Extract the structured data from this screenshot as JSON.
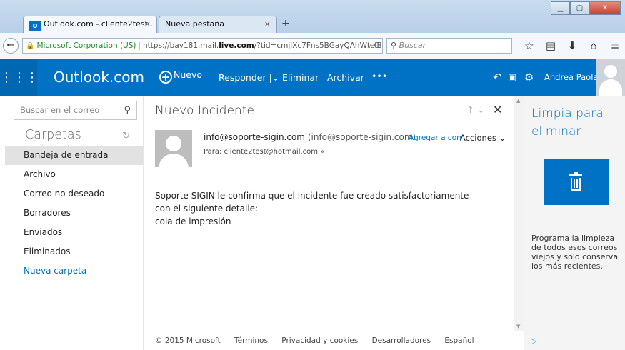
{
  "browser": {
    "tabs": [
      {
        "title": "Outlook.com - cliente2test...",
        "close": "×"
      },
      {
        "title": "Nueva pestaña",
        "close": "×"
      }
    ],
    "new_tab": "+",
    "window_buttons": {
      "minimize": "▁",
      "maximize": "▢",
      "close": "✕"
    },
    "back": "←",
    "address": {
      "identity": "Microsoft Corporation (US)",
      "url_prefix": "https://bay181.mail.",
      "url_host": "live.com",
      "url_rest": "/?tid=cmjlXc7Fns5BGayQAhWtelB",
      "tail": "▿ C"
    },
    "search_placeholder": "Buscar",
    "icons": [
      "star-icon",
      "reading-list-icon",
      "download-icon",
      "home-icon",
      "menu-icon"
    ]
  },
  "header": {
    "brand": "Outlook.com",
    "new_label": "Nuevo",
    "reply_label": "Responder",
    "delete_label": "Eliminar",
    "archive_label": "Archivar",
    "more_label": "•••",
    "user_name": "Andrea Paola"
  },
  "sidebar": {
    "search_placeholder": "Buscar en el correo",
    "folders_header": "Carpetas",
    "folders": [
      {
        "label": "Bandeja de entrada",
        "selected": true
      },
      {
        "label": "Archivo"
      },
      {
        "label": "Correo no deseado"
      },
      {
        "label": "Borradores"
      },
      {
        "label": "Enviados"
      },
      {
        "label": "Eliminados"
      }
    ],
    "new_folder": "Nueva carpeta"
  },
  "message": {
    "subject": "Nuevo Incidente",
    "from_email": "info@soporte-sigin.com",
    "from_display": "(info@soporte-sigin.com)",
    "add_contact": "Agregar a con",
    "actions": "Acciones",
    "to_line": "Para: cliente2test@hotmail.com",
    "body_lines": [
      "Soporte SIGIN le confirma que el incidente fue creado satisfactoriamente",
      "con el siguiente detalle:",
      "cola de impresión"
    ]
  },
  "ad": {
    "title": "Limpia para eliminar",
    "text": "Programa la limpieza de todos esos correos viejos y solo conserva los más recientes."
  },
  "footer": {
    "copyright": "© 2015 Microsoft",
    "links": [
      "Términos",
      "Privacidad y cookies",
      "Desarrolladores",
      "Español"
    ]
  },
  "colors": {
    "accent": "#0072c6",
    "selected_folder": "#e2e2e2",
    "ad_background": "#f4f4f4"
  }
}
